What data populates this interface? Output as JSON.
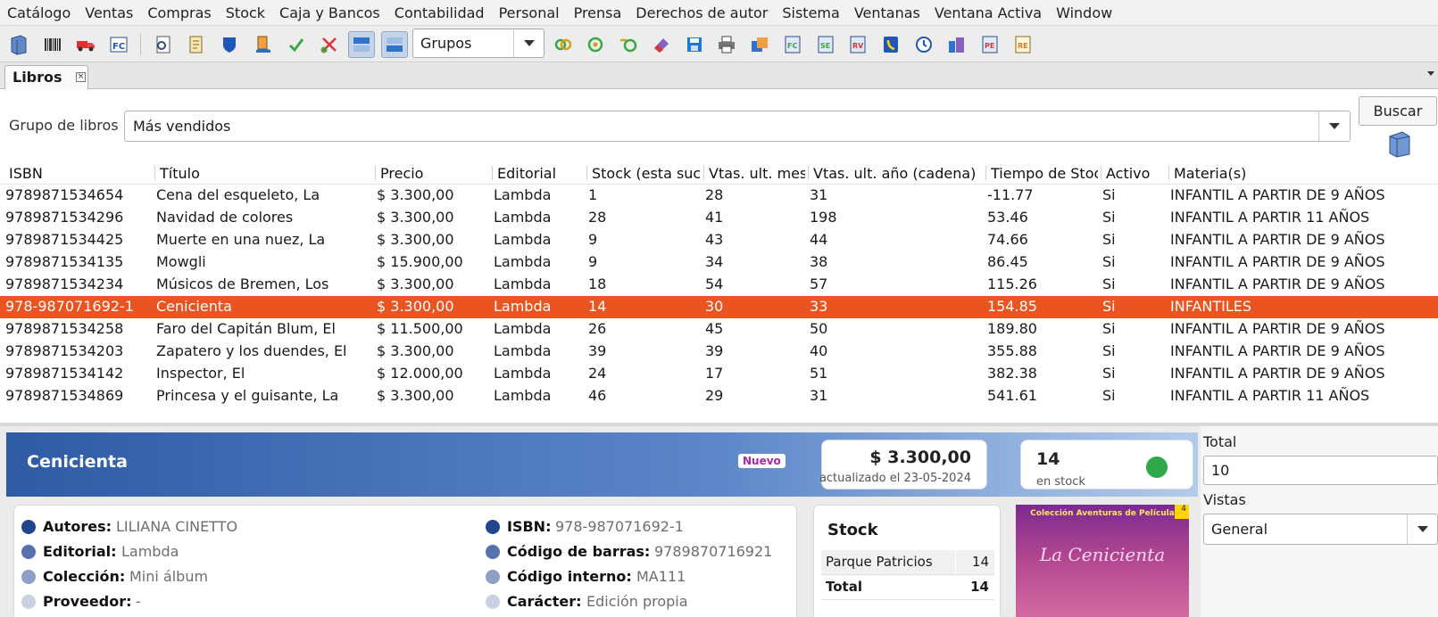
{
  "menu": [
    "Catálogo",
    "Ventas",
    "Compras",
    "Stock",
    "Caja y Bancos",
    "Contabilidad",
    "Personal",
    "Prensa",
    "Derechos de autor",
    "Sistema",
    "Ventanas",
    "Ventana Activa",
    "Window"
  ],
  "toolbar": {
    "combo_value": "Grupos",
    "icons_left": [
      "book-icon",
      "barcode-icon",
      "truck-icon",
      "invoice-fc-icon"
    ],
    "icons_mid": [
      "document-search-icon",
      "notepad-icon",
      "shield-icon",
      "hand-pay-icon",
      "checkmark-icon",
      "scissors-icon",
      "layout-top-icon",
      "layout-split-icon"
    ],
    "icons_right": [
      "link-rings-icon",
      "target-icon",
      "ring-key-icon",
      "eraser-icon",
      "save-icon",
      "printer-icon",
      "folders-icon",
      "doc-fc-icon",
      "doc-se-icon",
      "doc-rv-icon",
      "phone-book-icon",
      "clock-icon",
      "buildings-icon",
      "doc-pe-icon",
      "doc-re-icon"
    ]
  },
  "tab": {
    "label": "Libros",
    "close": "×"
  },
  "filter": {
    "label": "Grupo de libros",
    "value": "Más vendidos",
    "search_label": "Buscar"
  },
  "table": {
    "columns": [
      "ISBN",
      "Título",
      "Precio",
      "Editorial",
      "Stock (esta suc.",
      "Vtas. ult. mes",
      "Vtas. ult. año (cadena)",
      "Tiempo de Stoc",
      "Activo",
      "Materia(s)"
    ],
    "selected_index": 5,
    "rows": [
      [
        "9789871534654",
        "Cena del esqueleto, La",
        "$ 3.300,00",
        "Lambda",
        "1",
        "28",
        "31",
        "-11.77",
        "Si",
        "INFANTIL A PARTIR DE 9 AÑOS"
      ],
      [
        "9789871534296",
        "Navidad de colores",
        "$ 3.300,00",
        "Lambda",
        "28",
        "41",
        "198",
        "53.46",
        "Si",
        "INFANTIL A PARTIR 11 AÑOS"
      ],
      [
        "9789871534425",
        "Muerte en una nuez, La",
        "$ 3.300,00",
        "Lambda",
        "9",
        "43",
        "44",
        "74.66",
        "Si",
        "INFANTIL A PARTIR DE 9 AÑOS"
      ],
      [
        "9789871534135",
        "Mowgli",
        "$ 15.900,00",
        "Lambda",
        "9",
        "34",
        "38",
        "86.45",
        "Si",
        "INFANTIL A PARTIR DE 9 AÑOS"
      ],
      [
        "9789871534234",
        "Músicos de Bremen, Los",
        "$ 3.300,00",
        "Lambda",
        "18",
        "54",
        "57",
        "115.26",
        "Si",
        "INFANTIL A PARTIR DE 9 AÑOS"
      ],
      [
        "978-987071692-1",
        "Cenicienta",
        "$ 3.300,00",
        "Lambda",
        "14",
        "30",
        "33",
        "154.85",
        "Si",
        "INFANTILES"
      ],
      [
        "9789871534258",
        "Faro del Capitán Blum, El",
        "$ 11.500,00",
        "Lambda",
        "26",
        "45",
        "50",
        "189.80",
        "Si",
        "INFANTIL A PARTIR DE 9 AÑOS"
      ],
      [
        "9789871534203",
        "Zapatero y los duendes, El",
        "$ 3.300,00",
        "Lambda",
        "39",
        "39",
        "40",
        "355.88",
        "Si",
        "INFANTIL A PARTIR DE 9 AÑOS"
      ],
      [
        "9789871534142",
        "Inspector, El",
        "$ 12.000,00",
        "Lambda",
        "24",
        "17",
        "51",
        "382.38",
        "Si",
        "INFANTIL A PARTIR DE 9 AÑOS"
      ],
      [
        "9789871534869",
        "Princesa y el guisante, La",
        "$ 3.300,00",
        "Lambda",
        "46",
        "29",
        "31",
        "541.61",
        "Si",
        "INFANTIL A PARTIR 11 AÑOS"
      ]
    ]
  },
  "detail": {
    "title": "Cenicienta",
    "badge": "Nuevo",
    "price": "$ 3.300,00",
    "price_updated": "actualizado el 23-05-2024",
    "stock": "14",
    "stock_caption": "en stock",
    "stock_status_color": "#2ea84a",
    "meta_left": [
      {
        "key": "Autores:",
        "value": "LILIANA CINETTO",
        "color": "#22458f"
      },
      {
        "key": "Editorial:",
        "value": "Lambda",
        "color": "#5872ad"
      },
      {
        "key": "Colección:",
        "value": "Mini álbum",
        "color": "#8fa0c7"
      },
      {
        "key": "Proveedor:",
        "value": "-",
        "color": "#c9d0e2"
      }
    ],
    "meta_right": [
      {
        "key": "ISBN:",
        "value": "978-987071692-1",
        "color": "#22458f"
      },
      {
        "key": "Código de barras:",
        "value": "9789870716921",
        "color": "#5872ad"
      },
      {
        "key": "Código interno:",
        "value": "MA111",
        "color": "#8fa0c7"
      },
      {
        "key": "Carácter:",
        "value": "Edición propia",
        "color": "#c9d0e2"
      }
    ],
    "stock_panel": {
      "title": "Stock",
      "rows": [
        {
          "name": "Parque Patricios",
          "qty": "14"
        }
      ],
      "total_label": "Total",
      "total_qty": "14"
    },
    "cover": {
      "series": "Colección Aventuras de Película",
      "title": "La Cenicienta",
      "number": "4"
    }
  },
  "side": {
    "total_label": "Total",
    "total_value": "10",
    "views_label": "Vistas",
    "views_value": "General"
  },
  "colors": {
    "selection": "#e95420",
    "banner_start": "#2f5ba5",
    "banner_end": "#b3cbea"
  }
}
